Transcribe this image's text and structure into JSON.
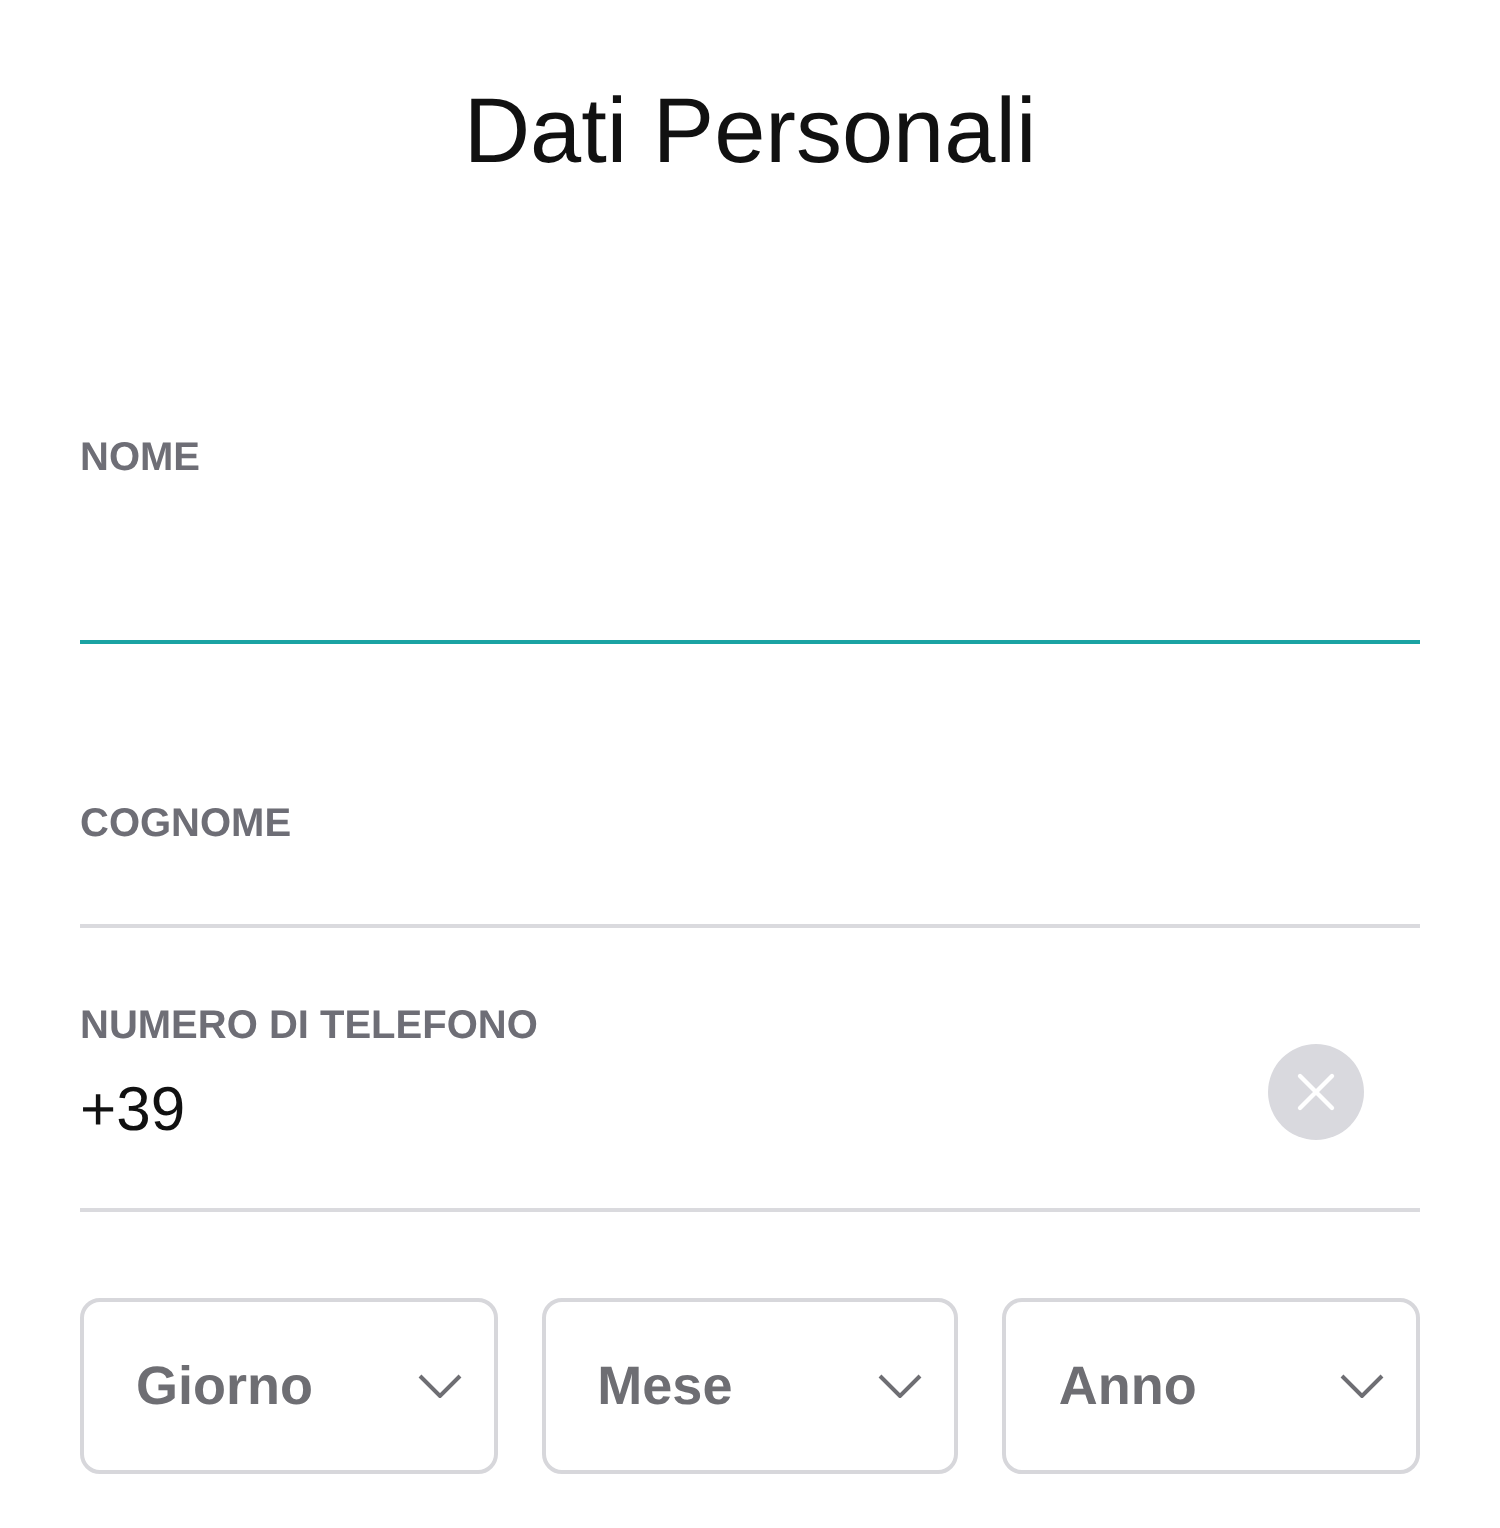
{
  "title": "Dati Personali",
  "fields": [
    {
      "label": "NOME",
      "focused": true
    },
    {
      "label": "COGNOME",
      "focused": false
    },
    {
      "label": "NUMERO DI TELEFONO",
      "value": "+39",
      "focused": false
    }
  ],
  "date_selects": [
    {
      "placeholder": "Giorno"
    },
    {
      "placeholder": "Mese"
    },
    {
      "placeholder": "Anno"
    }
  ]
}
